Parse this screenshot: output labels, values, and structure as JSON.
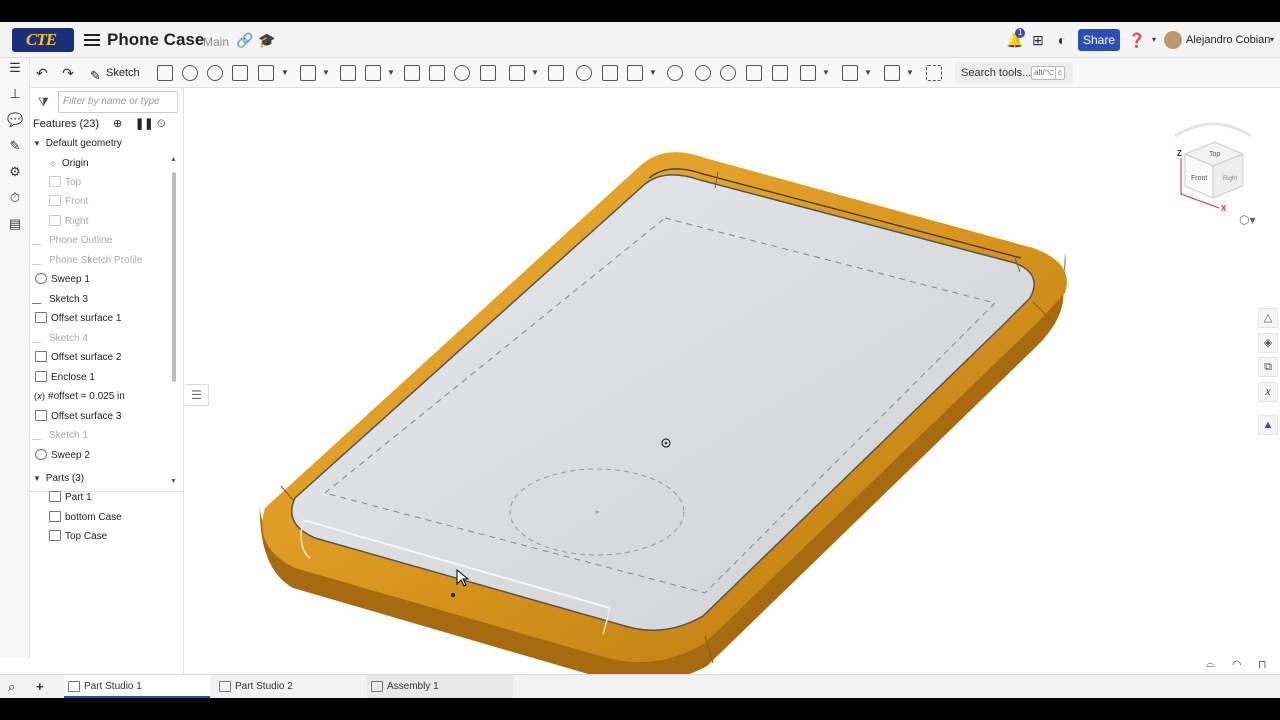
{
  "header": {
    "logo_text": "CTE",
    "doc_title": "Phone Case",
    "branch": "Main",
    "notification_count": "1",
    "share_label": "Share",
    "user_name": "Alejandro Cobian"
  },
  "toolbar": {
    "sketch_label": "Sketch",
    "search_label": "Search tools...",
    "search_shortcut_1": "alt/⌥",
    "search_shortcut_2": "c"
  },
  "panel": {
    "filter_placeholder": "Filter by name or type",
    "features_header": "Features (23)",
    "features": [
      {
        "label": "Default geometry",
        "dim": false
      },
      {
        "label": "Origin",
        "dim": false
      },
      {
        "label": "Top",
        "dim": true
      },
      {
        "label": "Front",
        "dim": true
      },
      {
        "label": "Right",
        "dim": true
      },
      {
        "label": "Phone Outline",
        "dim": true
      },
      {
        "label": "Phone Sketch Profile",
        "dim": true
      },
      {
        "label": "Sweep 1",
        "dim": false
      },
      {
        "label": "Sketch 3",
        "dim": false
      },
      {
        "label": "Offset surface 1",
        "dim": false
      },
      {
        "label": "Sketch 4",
        "dim": true
      },
      {
        "label": "Offset surface 2",
        "dim": false
      },
      {
        "label": "Enclose 1",
        "dim": false
      },
      {
        "label": "#offset = 0.025 in",
        "dim": false
      },
      {
        "label": "Offset surface 3",
        "dim": false
      },
      {
        "label": "Sketch 1",
        "dim": true
      },
      {
        "label": "Sweep 2",
        "dim": false
      }
    ],
    "parts_header": "Parts (3)",
    "parts": [
      "Part 1",
      "bottom Case",
      "Top Case"
    ]
  },
  "viewcube": {
    "top": "Top",
    "front": "Front",
    "right": "Right",
    "axis_z": "Z",
    "axis_x": "X"
  },
  "tabs": [
    "Part Studio 1",
    "Part Studio 2",
    "Assembly 1"
  ],
  "colors": {
    "accent": "#2d4fb4",
    "case_orange": "#d8961e",
    "case_inner": "#d9dbdf"
  }
}
